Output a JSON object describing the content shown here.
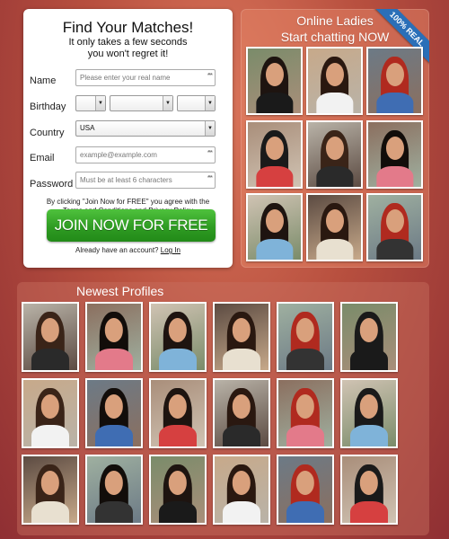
{
  "signup": {
    "title": "Find Your Matches!",
    "subtitle_line1": "It only takes a few seconds",
    "subtitle_line2": "you won't regret it!",
    "name_label": "Name",
    "name_placeholder": "Please enter your real name",
    "birthday_label": "Birthday",
    "country_label": "Country",
    "country_value": "USA",
    "email_label": "Email",
    "email_placeholder": "example@example.com",
    "password_label": "Password",
    "password_placeholder": "Must be at least 6 characters",
    "required_marker": "***",
    "terms_text": "By clicking \"Join Now for FREE\" you agree with the",
    "terms_link": "Terms and Conditions",
    "terms_and": "and",
    "privacy_link": "Privacy Policy",
    "join_button": "JOIN NOW FOR FREE",
    "login_prompt": "Already have an account?",
    "login_link": "Log In"
  },
  "online": {
    "title_line1": "Online Ladies",
    "title_line2": "Start chatting NOW",
    "badge": "100% REAL"
  },
  "newest": {
    "title": "Newest Profiles"
  },
  "colors": {
    "background": "#b8503f",
    "join_button": "#2f9c23",
    "badge": "#2a6fb8"
  }
}
